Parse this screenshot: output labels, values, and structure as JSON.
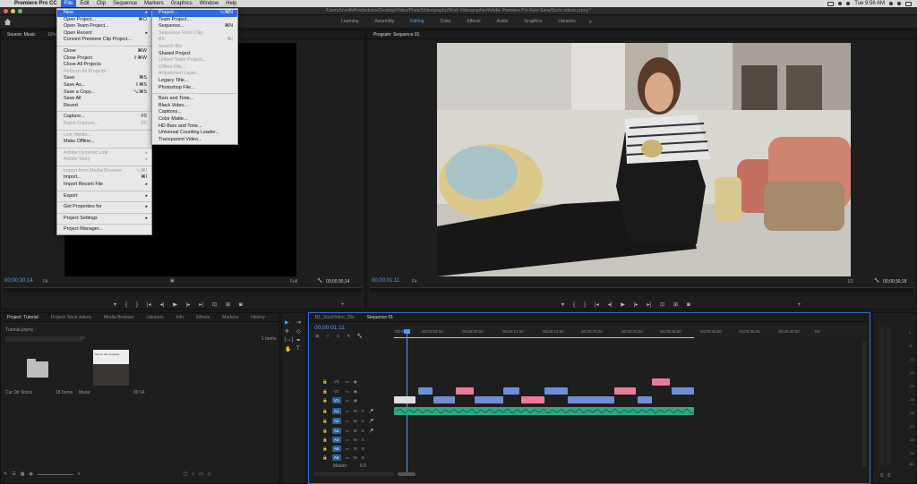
{
  "menubar": {
    "apple": "",
    "app_name": "Premiere Pro CC",
    "menus": [
      "File",
      "Edit",
      "Clip",
      "Sequence",
      "Markers",
      "Graphics",
      "Window",
      "Help"
    ],
    "clock": "Tue 9:56 AM"
  },
  "window": {
    "title": "/Users/LivelifeProductions/Desktop/Video/Photo/Videography/Work Videographer/Adobe Premiere Pro Auto-Save/Sock videos.prproj *"
  },
  "workspaces": {
    "tabs": [
      "Learning",
      "Assembly",
      "Editing",
      "Color",
      "Effects",
      "Audio",
      "Graphics",
      "Libraries"
    ],
    "active": "Editing",
    "more": "»"
  },
  "source_panel": {
    "tab_label": "Source: Music",
    "tab2_label": "Effect Co",
    "timecode_left": "00;00;30;14",
    "fit_label": "Fit",
    "full_label": "Full",
    "timecode_right": "00;00;30;14"
  },
  "program_panel": {
    "tab_label": "Program: Sequence 01",
    "timecode_left": "00;00;01;11",
    "fit_label": "Fit",
    "ratio_label": "1/2",
    "timecode_right": "00;00;30;18"
  },
  "file_menu": {
    "items": [
      {
        "label": "New",
        "shortcut": "",
        "submenu": true,
        "highlight": true,
        "disabled": false
      },
      {
        "label": "Open Project...",
        "shortcut": "⌘O",
        "submenu": false,
        "disabled": false
      },
      {
        "label": "Open Team Project...",
        "shortcut": "",
        "submenu": false,
        "disabled": false
      },
      {
        "label": "Open Recent",
        "shortcut": "",
        "submenu": true,
        "disabled": false
      },
      {
        "label": "Convert Premiere Clip Project...",
        "shortcut": "",
        "submenu": false,
        "disabled": false
      },
      {
        "sep": true
      },
      {
        "label": "Close",
        "shortcut": "⌘W",
        "submenu": false,
        "disabled": false
      },
      {
        "label": "Close Project",
        "shortcut": "⇧⌘W",
        "submenu": false,
        "disabled": false
      },
      {
        "label": "Close All Projects",
        "shortcut": "",
        "submenu": false,
        "disabled": false
      },
      {
        "label": "Refresh All Projects",
        "shortcut": "",
        "submenu": false,
        "disabled": true
      },
      {
        "label": "Save",
        "shortcut": "⌘S",
        "submenu": false,
        "disabled": false
      },
      {
        "label": "Save As...",
        "shortcut": "⇧⌘S",
        "submenu": false,
        "disabled": false
      },
      {
        "label": "Save a Copy...",
        "shortcut": "⌥⌘S",
        "submenu": false,
        "disabled": false
      },
      {
        "label": "Save All",
        "shortcut": "",
        "submenu": false,
        "disabled": false
      },
      {
        "label": "Revert",
        "shortcut": "",
        "submenu": false,
        "disabled": false
      },
      {
        "sep": true
      },
      {
        "label": "Capture...",
        "shortcut": "F5",
        "submenu": false,
        "disabled": false
      },
      {
        "label": "Batch Capture...",
        "shortcut": "F6",
        "submenu": false,
        "disabled": true
      },
      {
        "sep": true
      },
      {
        "label": "Link Media...",
        "shortcut": "",
        "submenu": false,
        "disabled": true
      },
      {
        "label": "Make Offline...",
        "shortcut": "",
        "submenu": false,
        "disabled": false
      },
      {
        "sep": true
      },
      {
        "label": "Adobe Dynamic Link",
        "shortcut": "",
        "submenu": true,
        "disabled": true
      },
      {
        "label": "Adobe Story",
        "shortcut": "",
        "submenu": true,
        "disabled": true
      },
      {
        "sep": true
      },
      {
        "label": "Import from Media Browser",
        "shortcut": "⌥⌘I",
        "submenu": false,
        "disabled": true
      },
      {
        "label": "Import...",
        "shortcut": "⌘I",
        "submenu": false,
        "disabled": false
      },
      {
        "label": "Import Recent File",
        "shortcut": "",
        "submenu": true,
        "disabled": false
      },
      {
        "sep": true
      },
      {
        "label": "Export",
        "shortcut": "",
        "submenu": true,
        "disabled": false
      },
      {
        "sep": true
      },
      {
        "label": "Get Properties for",
        "shortcut": "",
        "submenu": true,
        "disabled": false
      },
      {
        "sep": true
      },
      {
        "label": "Project Settings",
        "shortcut": "",
        "submenu": true,
        "disabled": false
      },
      {
        "sep": true
      },
      {
        "label": "Project Manager...",
        "shortcut": "",
        "submenu": false,
        "disabled": false
      }
    ]
  },
  "new_submenu": {
    "items": [
      {
        "label": "Project...",
        "shortcut": "⌥⌘N",
        "highlight": true,
        "disabled": false
      },
      {
        "label": "Team Project...",
        "shortcut": "",
        "disabled": false
      },
      {
        "label": "Sequence...",
        "shortcut": "⌘N",
        "disabled": false
      },
      {
        "label": "Sequence From Clip",
        "shortcut": "",
        "disabled": true
      },
      {
        "label": "Bin",
        "shortcut": "⌘/",
        "disabled": true
      },
      {
        "label": "Search Bin",
        "shortcut": "",
        "disabled": true
      },
      {
        "label": "Shared Project",
        "shortcut": "",
        "disabled": false
      },
      {
        "label": "Linked Team Project...",
        "shortcut": "",
        "disabled": true
      },
      {
        "label": "Offline File...",
        "shortcut": "",
        "disabled": true
      },
      {
        "label": "Adjustment Layer...",
        "shortcut": "",
        "disabled": true
      },
      {
        "label": "Legacy Title...",
        "shortcut": "",
        "disabled": false
      },
      {
        "label": "Photoshop File...",
        "shortcut": "",
        "disabled": false
      },
      {
        "sep": true
      },
      {
        "label": "Bars and Tone...",
        "shortcut": "",
        "disabled": false
      },
      {
        "label": "Black Video...",
        "shortcut": "",
        "disabled": false
      },
      {
        "label": "Captions...",
        "shortcut": "",
        "disabled": false
      },
      {
        "label": "Color Matte...",
        "shortcut": "",
        "disabled": false
      },
      {
        "label": "HD Bars and Tone...",
        "shortcut": "",
        "disabled": false
      },
      {
        "label": "Universal Counting Leader...",
        "shortcut": "",
        "disabled": false
      },
      {
        "label": "Transparent Video...",
        "shortcut": "",
        "disabled": false
      }
    ]
  },
  "project_panel": {
    "tabs": [
      "Project: Tutorial",
      "Project: Sock videos",
      "Media Browser",
      "Libraries",
      "Info",
      "Effects",
      "Markers",
      "History"
    ],
    "file_name": "Tutorial.prproj",
    "items_count": "1 Items",
    "items": [
      {
        "name": "Car Dit Sticks",
        "meta": "18 Items"
      },
      {
        "name": "Music",
        "meta": "30:14"
      }
    ],
    "thumb_caption": "Tap for the complete..."
  },
  "timeline": {
    "tabs": [
      "B1_SockVideo_15s",
      "Sequence 01"
    ],
    "timecode": "00;00;01;11",
    "ruler": [
      ":00;00",
      "00;00;04;00",
      "00;00;08;00",
      "00;00;12;00",
      "00;00;16;00",
      "00;00;20;00",
      "00;00;24;00",
      "00;00;28;00",
      "00;00;32;00",
      "00;00;36;00",
      "00;00;40;00",
      "00;"
    ],
    "video_tracks": [
      "V3",
      "V2",
      "V1"
    ],
    "audio_tracks": [
      "A1",
      "A2",
      "A3",
      "A4",
      "A5",
      "A6",
      "A7"
    ],
    "master_label": "Master",
    "master_value": "0.0"
  },
  "audio_meter": {
    "labels": [
      "0",
      "-6",
      "-12",
      "-18",
      "-24",
      "-30",
      "-36",
      "-42",
      "-48",
      "-54",
      "dB"
    ],
    "bottom": [
      "S",
      "S"
    ]
  },
  "colors": {
    "accent": "#4a9ff5",
    "clip_video": "#6e8fd6",
    "clip_pink": "#e77b9b",
    "clip_audio": "#2fa883",
    "playhead": "#4a9ff5"
  }
}
